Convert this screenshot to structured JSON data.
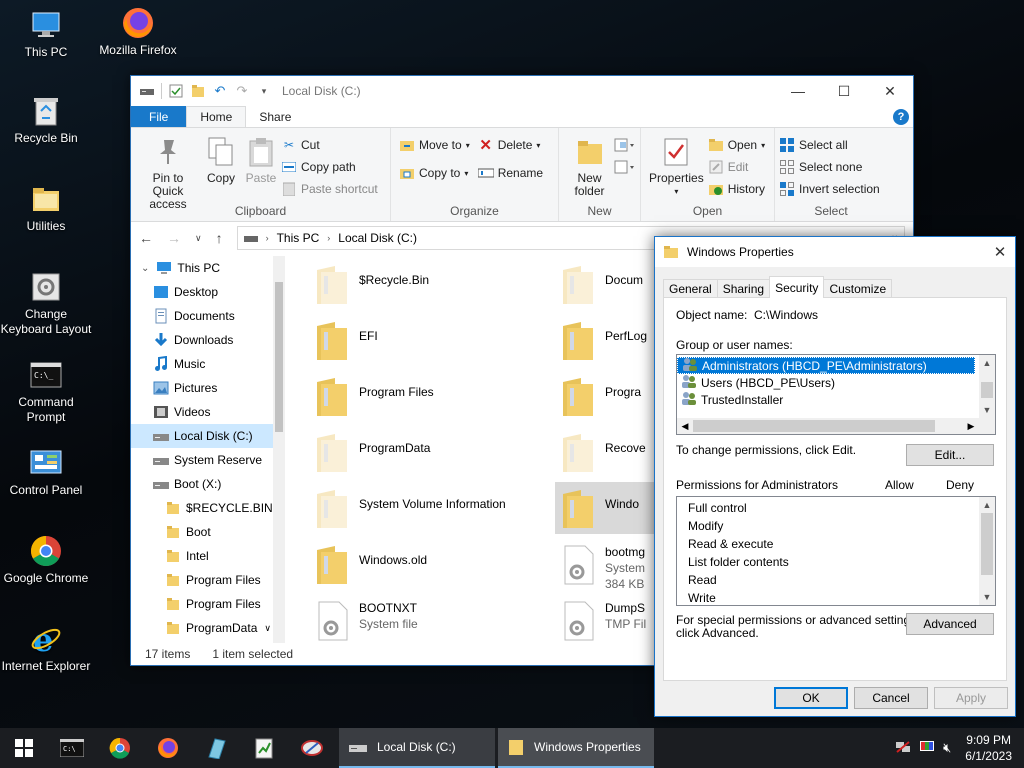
{
  "desktop": {
    "icons": [
      {
        "label": "This PC",
        "icon": "this-pc-icon"
      },
      {
        "label": "Mozilla Firefox",
        "icon": "firefox-icon"
      },
      {
        "label": "Recycle Bin",
        "icon": "recycle-bin-icon"
      },
      {
        "label": "Utilities",
        "icon": "folder-icon"
      },
      {
        "label": "Change Keyboard Layout",
        "icon": "keyboard-settings-icon"
      },
      {
        "label": "Command Prompt",
        "icon": "command-prompt-icon"
      },
      {
        "label": "Control Panel",
        "icon": "control-panel-icon"
      },
      {
        "label": "Google Chrome",
        "icon": "chrome-icon"
      },
      {
        "label": "Internet Explorer",
        "icon": "internet-explorer-icon"
      }
    ]
  },
  "explorer": {
    "title": "Local Disk (C:)",
    "tabs": {
      "file": "File",
      "home": "Home",
      "share": "Share"
    },
    "ribbon": {
      "pin": "Pin to Quick access",
      "copy": "Copy",
      "paste": "Paste",
      "cut": "Cut",
      "copy_path": "Copy path",
      "paste_shortcut": "Paste shortcut",
      "clipboard": "Clipboard",
      "move_to": "Move to",
      "copy_to": "Copy to",
      "delete": "Delete",
      "rename": "Rename",
      "organize": "Organize",
      "new_folder": "New folder",
      "new": "New",
      "properties": "Properties",
      "open": "Open",
      "edit": "Edit",
      "history": "History",
      "open_group": "Open",
      "select_all": "Select all",
      "select_none": "Select none",
      "invert_selection": "Invert selection",
      "select": "Select"
    },
    "breadcrumb": [
      "This PC",
      "Local Disk (C:)"
    ],
    "nav": [
      {
        "label": "This PC",
        "icon": "this-pc-icon",
        "indent": 1
      },
      {
        "label": "Desktop",
        "icon": "desktop-folder-icon",
        "indent": 2
      },
      {
        "label": "Documents",
        "icon": "documents-icon",
        "indent": 2
      },
      {
        "label": "Downloads",
        "icon": "downloads-icon",
        "indent": 2
      },
      {
        "label": "Music",
        "icon": "music-icon",
        "indent": 2
      },
      {
        "label": "Pictures",
        "icon": "pictures-icon",
        "indent": 2
      },
      {
        "label": "Videos",
        "icon": "videos-icon",
        "indent": 2
      },
      {
        "label": "Local Disk (C:)",
        "icon": "drive-icon",
        "indent": 2,
        "selected": true
      },
      {
        "label": "System Reserve",
        "icon": "drive-icon",
        "indent": 2
      },
      {
        "label": "Boot (X:)",
        "icon": "drive-icon",
        "indent": 2
      },
      {
        "label": "$RECYCLE.BIN",
        "icon": "folder-icon",
        "indent": 3
      },
      {
        "label": "Boot",
        "icon": "folder-icon",
        "indent": 3
      },
      {
        "label": "Intel",
        "icon": "folder-icon",
        "indent": 3
      },
      {
        "label": "Program Files",
        "icon": "folder-icon",
        "indent": 3
      },
      {
        "label": "Program Files",
        "icon": "folder-icon",
        "indent": 3
      },
      {
        "label": "ProgramData",
        "icon": "folder-icon",
        "indent": 3
      }
    ],
    "files_left": [
      {
        "name": "$Recycle.Bin",
        "sub": "",
        "type": "folder-faded"
      },
      {
        "name": "EFI",
        "sub": "",
        "type": "folder"
      },
      {
        "name": "Program Files",
        "sub": "",
        "type": "folder"
      },
      {
        "name": "ProgramData",
        "sub": "",
        "type": "folder-faded"
      },
      {
        "name": "System Volume Information",
        "sub": "",
        "type": "folder-faded"
      },
      {
        "name": "Windows.old",
        "sub": "",
        "type": "folder"
      },
      {
        "name": "BOOTNXT",
        "sub": "System file",
        "type": "file"
      }
    ],
    "files_right": [
      {
        "name": "Docum",
        "sub": "",
        "type": "folder-faded"
      },
      {
        "name": "PerfLog",
        "sub": "",
        "type": "folder"
      },
      {
        "name": "Progra",
        "sub": "",
        "type": "folder"
      },
      {
        "name": "Recove",
        "sub": "",
        "type": "folder-faded"
      },
      {
        "name": "Windo",
        "sub": "",
        "type": "folder",
        "selected": true
      },
      {
        "name": "bootmg",
        "sub": "System",
        "sub2": "384 KB",
        "type": "file"
      },
      {
        "name": "DumpS",
        "sub": "TMP Fil",
        "type": "file"
      }
    ],
    "status_items": "17 items",
    "status_selected": "1 item selected"
  },
  "dialog": {
    "title": "Windows Properties",
    "tabs": [
      "General",
      "Sharing",
      "Security",
      "Customize"
    ],
    "object_name_label": "Object name:",
    "object_name_value": "C:\\Windows",
    "group_label": "Group or user names:",
    "users": [
      {
        "name": "Administrators (HBCD_PE\\Administrators)",
        "selected": true
      },
      {
        "name": "Users (HBCD_PE\\Users)",
        "selected": false
      },
      {
        "name": "TrustedInstaller",
        "selected": false
      }
    ],
    "change_hint": "To change permissions, click Edit.",
    "edit_button": "Edit...",
    "permissions_label": "Permissions for Administrators",
    "allow": "Allow",
    "deny": "Deny",
    "permissions": [
      "Full control",
      "Modify",
      "Read & execute",
      "List folder contents",
      "Read",
      "Write"
    ],
    "special_hint_1": "For special permissions or advanced settings,",
    "special_hint_2": "click Advanced.",
    "advanced_button": "Advanced",
    "ok": "OK",
    "cancel": "Cancel",
    "apply": "Apply"
  },
  "taskbar": {
    "explorer_window": "Local Disk (C:)",
    "properties_window": "Windows Properties",
    "time": "9:09 PM",
    "date": "6/1/2023"
  },
  "colors": {
    "accent": "#0078d7",
    "file_tab": "#1979ca",
    "folder": "#f3cf6b",
    "selection": "#cce8ff"
  }
}
